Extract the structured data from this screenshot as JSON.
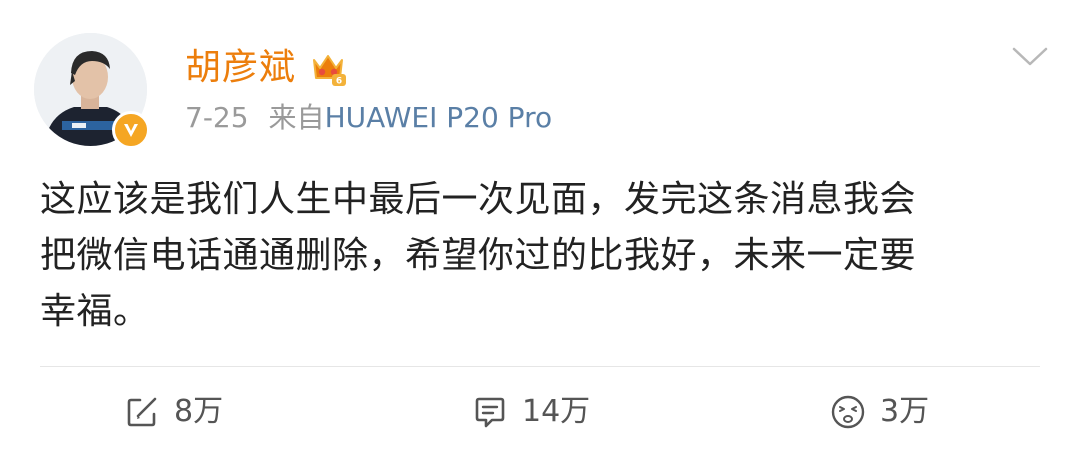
{
  "user": {
    "name": "胡彦斌",
    "verified": true
  },
  "meta": {
    "date": "7-25",
    "from_label": "来自",
    "device": "HUAWEI P20 Pro"
  },
  "post": {
    "lines": [
      "这应该是我们人生中最后一次见面，发完这条消息我会",
      "把微信电话通通删除，希望你过的比我好，未来一定要",
      "幸福。"
    ]
  },
  "actions": {
    "repost_count": "8万",
    "comment_count": "14万",
    "like_count": "3万"
  },
  "colors": {
    "username": "#ec7e0c",
    "device_link": "#5a7fa6",
    "meta_gray": "#9a9a9a",
    "text": "#222222",
    "verified_badge": "#f5a623"
  },
  "icons": {
    "vip": "vip-crown-icon",
    "menu": "chevron-down-icon",
    "repost": "repost-icon",
    "comment": "comment-icon",
    "like": "emoji-face-icon"
  }
}
